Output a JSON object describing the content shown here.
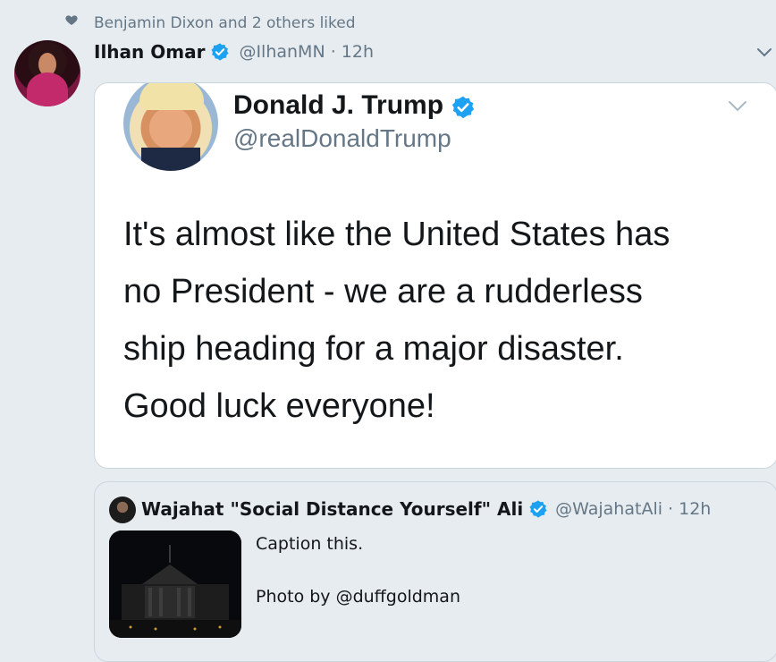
{
  "social_context": {
    "text": "Benjamin Dixon and 2 others liked",
    "icon": "heart-icon"
  },
  "tweet": {
    "author_name": "Ilhan Omar",
    "author_handle": "@IlhanMN · 12h",
    "verified": true
  },
  "quoted_image": {
    "name": "Donald J. Trump",
    "handle": "@realDonaldTrump",
    "text_lines": [
      "It's almost like the United States has",
      "no President - we are a rudderless",
      "ship heading for a major disaster.",
      "Good luck everyone!"
    ]
  },
  "retweet": {
    "author_name": "Wajahat \"Social Distance Yourself\" Ali",
    "author_handle": "@WajahatAli · 12h",
    "caption": "Caption this.",
    "photo_credit": "Photo by @duffgoldman"
  },
  "colors": {
    "background": "#e6ecf0",
    "verified": "#1da1f2",
    "secondary_text": "#657786",
    "primary_text": "#14171a"
  }
}
